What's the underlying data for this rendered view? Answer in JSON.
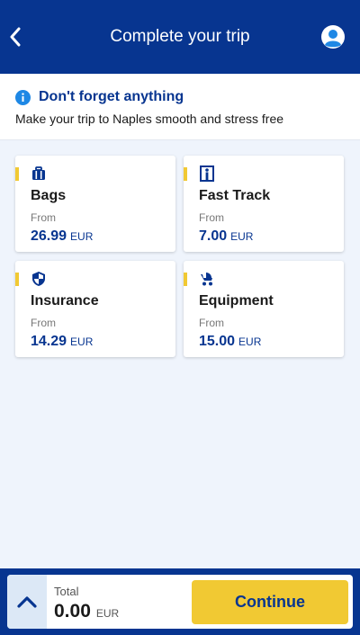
{
  "header": {
    "title": "Complete your trip",
    "back_icon": "chevron-left-icon",
    "avatar_icon": "user-avatar-icon"
  },
  "banner": {
    "title": "Don't forget anything",
    "subtitle": "Make your trip to Naples smooth and stress free",
    "icon": "info-icon"
  },
  "cards": [
    {
      "name": "Bags",
      "from_label": "From",
      "price": "26.99",
      "currency": "EUR",
      "icon": "luggage-icon"
    },
    {
      "name": "Fast Track",
      "from_label": "From",
      "price": "7.00",
      "currency": "EUR",
      "icon": "fast-track-gate-icon"
    },
    {
      "name": "Insurance",
      "from_label": "From",
      "price": "14.29",
      "currency": "EUR",
      "icon": "shield-icon"
    },
    {
      "name": "Equipment",
      "from_label": "From",
      "price": "15.00",
      "currency": "EUR",
      "icon": "stroller-icon"
    }
  ],
  "footer": {
    "total_label": "Total",
    "total_value": "0.00",
    "currency": "EUR",
    "continue_label": "Continue",
    "expand_icon": "chevron-up-icon"
  },
  "colors": {
    "brand_blue": "#073590",
    "accent_yellow": "#f1c933",
    "page_background": "#eff4fc",
    "info_blue": "#1e88e5"
  }
}
